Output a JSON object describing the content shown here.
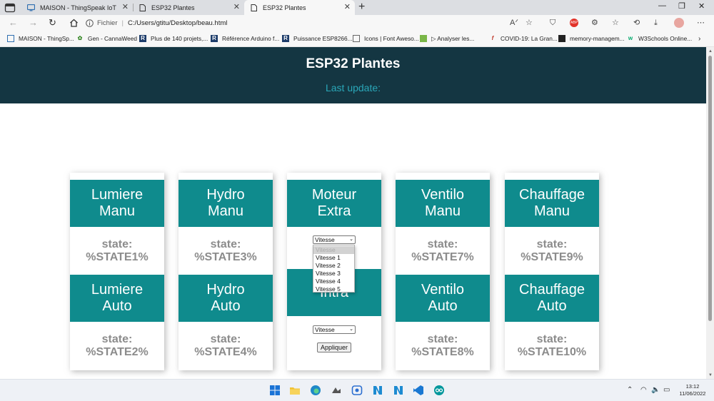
{
  "browser": {
    "tabs": [
      {
        "title": "MAISON - ThingSpeak IoT"
      },
      {
        "title": "ESP32 Plantes"
      },
      {
        "title": "ESP32 Plantes"
      }
    ],
    "address": {
      "protocol": "Fichier",
      "url": "C:/Users/gtitu/Desktop/beau.html"
    },
    "favorites": [
      {
        "label": "MAISON - ThingSp..."
      },
      {
        "label": "Gen - CannaWeed"
      },
      {
        "label": "Plus de 140 projets,..."
      },
      {
        "label": "Référence Arduino f..."
      },
      {
        "label": "Puissance ESP8266..."
      },
      {
        "label": "Icons | Font Aweso..."
      },
      {
        "label": "▷ Analyser les..."
      },
      {
        "label": "COVID-19: La Gran..."
      },
      {
        "label": "memory-managem..."
      },
      {
        "label": "W3Schools Online..."
      }
    ]
  },
  "page": {
    "title": "ESP32 Plantes",
    "last_update": "Last update:",
    "cards": [
      {
        "top": {
          "title_line1": "Lumiere",
          "title_line2": "Manu",
          "state_label": "state:",
          "state_value": "%STATE1%"
        },
        "bottom": {
          "title_line1": "Lumiere",
          "title_line2": "Auto",
          "state_label": "state:",
          "state_value": "%STATE2%"
        }
      },
      {
        "top": {
          "title_line1": "Hydro",
          "title_line2": "Manu",
          "state_label": "state:",
          "state_value": "%STATE3%"
        },
        "bottom": {
          "title_line1": "Hydro",
          "title_line2": "Auto",
          "state_label": "state:",
          "state_value": "%STATE4%"
        }
      },
      {
        "top": {
          "title_line1": "Moteur",
          "title_line2": "Extra",
          "select_value": "Vitesse"
        },
        "bottom": {
          "title_line1": "",
          "title_line2": "Intra",
          "select_value": "Vitesse",
          "button_label": "Appliquer"
        }
      },
      {
        "top": {
          "title_line1": "Ventilo",
          "title_line2": "Manu",
          "state_label": "state:",
          "state_value": "%STATE7%"
        },
        "bottom": {
          "title_line1": "Ventilo",
          "title_line2": "Auto",
          "state_label": "state:",
          "state_value": "%STATE8%"
        }
      },
      {
        "top": {
          "title_line1": "Chauffage",
          "title_line2": "Manu",
          "state_label": "state:",
          "state_value": "%STATE9%"
        },
        "bottom": {
          "title_line1": "Chauffage",
          "title_line2": "Auto",
          "state_label": "state:",
          "state_value": "%STATE10%"
        }
      }
    ],
    "dropdown_options": [
      "Vitesse",
      "Vitesse 1",
      "Vitesse 2",
      "Vitesse 3",
      "Vitesse 4",
      "Vitesse 5"
    ]
  },
  "taskbar": {
    "time": "13:12",
    "date": "11/06/2022"
  },
  "colors": {
    "header_bg": "#143642",
    "accent": "#0f8b8d",
    "update_text": "#2aa7b8",
    "state_text": "#8c8c8c"
  }
}
